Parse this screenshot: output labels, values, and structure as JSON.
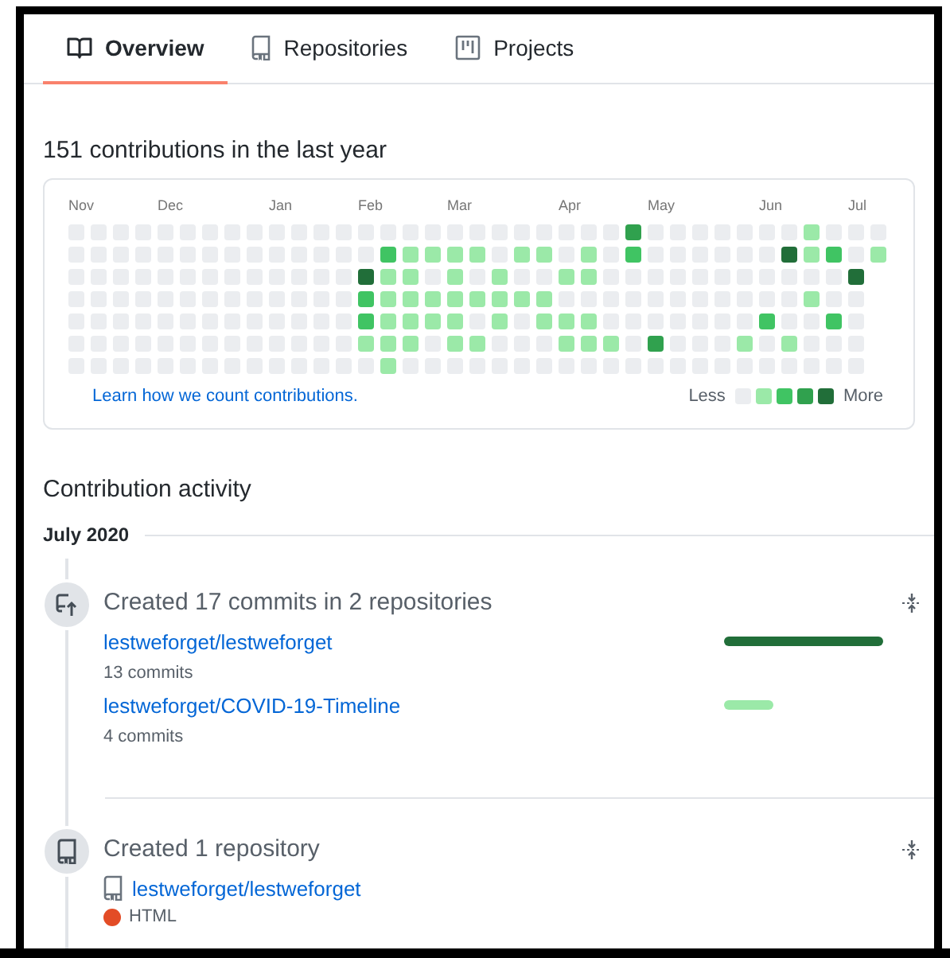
{
  "tabs": [
    {
      "label": "Overview",
      "selected": true
    },
    {
      "label": "Repositories",
      "selected": false
    },
    {
      "label": "Projects",
      "selected": false
    }
  ],
  "contributions": {
    "heading": "151 contributions in the last year",
    "months": [
      "Nov",
      "Dec",
      "Jan",
      "Feb",
      "Mar",
      "Apr",
      "May",
      "Jun",
      "Jul"
    ],
    "rows": [
      [
        {
          "color": "#ebedf0"
        },
        {
          "color": "#ebedf0"
        },
        {
          "color": "#ebedf0"
        },
        {
          "color": "#ebedf0"
        },
        {
          "color": "#ebedf0"
        },
        {
          "color": "#ebedf0"
        },
        {
          "color": "#ebedf0"
        },
        {
          "color": "#ebedf0"
        },
        {
          "color": "#ebedf0"
        },
        {
          "color": "#ebedf0"
        },
        {
          "color": "#ebedf0"
        },
        {
          "color": "#ebedf0"
        },
        {
          "color": "#ebedf0"
        },
        {
          "color": "#ebedf0"
        },
        {
          "color": "#ebedf0"
        },
        {
          "color": "#ebedf0"
        },
        {
          "color": "#ebedf0"
        },
        {
          "color": "#ebedf0"
        },
        {
          "color": "#ebedf0"
        },
        {
          "color": "#ebedf0"
        },
        {
          "color": "#ebedf0"
        },
        {
          "color": "#ebedf0"
        },
        {
          "color": "#ebedf0"
        },
        {
          "color": "#ebedf0"
        },
        {
          "color": "#ebedf0"
        },
        {
          "color": "#30a14e"
        },
        {
          "color": "#ebedf0"
        },
        {
          "color": "#ebedf0"
        },
        {
          "color": "#ebedf0"
        },
        {
          "color": "#ebedf0"
        },
        {
          "color": "#ebedf0"
        },
        {
          "color": "#ebedf0"
        },
        {
          "color": "#ebedf0"
        },
        {
          "color": "#9be9a8"
        },
        {
          "color": "#ebedf0"
        },
        {
          "color": "#ebedf0"
        },
        {
          "color": "#ebedf0"
        }
      ],
      [
        {
          "color": "#ebedf0"
        },
        {
          "color": "#ebedf0"
        },
        {
          "color": "#ebedf0"
        },
        {
          "color": "#ebedf0"
        },
        {
          "color": "#ebedf0"
        },
        {
          "color": "#ebedf0"
        },
        {
          "color": "#ebedf0"
        },
        {
          "color": "#ebedf0"
        },
        {
          "color": "#ebedf0"
        },
        {
          "color": "#ebedf0"
        },
        {
          "color": "#ebedf0"
        },
        {
          "color": "#ebedf0"
        },
        {
          "color": "#ebedf0"
        },
        {
          "color": "#ebedf0"
        },
        {
          "color": "#40c463"
        },
        {
          "color": "#9be9a8"
        },
        {
          "color": "#9be9a8"
        },
        {
          "color": "#9be9a8"
        },
        {
          "color": "#9be9a8"
        },
        {
          "color": "#ebedf0"
        },
        {
          "color": "#9be9a8"
        },
        {
          "color": "#9be9a8"
        },
        {
          "color": "#ebedf0"
        },
        {
          "color": "#9be9a8"
        },
        {
          "color": "#ebedf0"
        },
        {
          "color": "#40c463"
        },
        {
          "color": "#ebedf0"
        },
        {
          "color": "#ebedf0"
        },
        {
          "color": "#ebedf0"
        },
        {
          "color": "#ebedf0"
        },
        {
          "color": "#ebedf0"
        },
        {
          "color": "#ebedf0"
        },
        {
          "color": "#216e39"
        },
        {
          "color": "#9be9a8"
        },
        {
          "color": "#40c463"
        },
        {
          "color": "#ebedf0"
        },
        {
          "color": "#9be9a8"
        }
      ],
      [
        {
          "color": "#ebedf0"
        },
        {
          "color": "#ebedf0"
        },
        {
          "color": "#ebedf0"
        },
        {
          "color": "#ebedf0"
        },
        {
          "color": "#ebedf0"
        },
        {
          "color": "#ebedf0"
        },
        {
          "color": "#ebedf0"
        },
        {
          "color": "#ebedf0"
        },
        {
          "color": "#ebedf0"
        },
        {
          "color": "#ebedf0"
        },
        {
          "color": "#ebedf0"
        },
        {
          "color": "#ebedf0"
        },
        {
          "color": "#ebedf0"
        },
        {
          "color": "#216e39"
        },
        {
          "color": "#9be9a8"
        },
        {
          "color": "#9be9a8"
        },
        {
          "color": "#ebedf0"
        },
        {
          "color": "#9be9a8"
        },
        {
          "color": "#ebedf0"
        },
        {
          "color": "#9be9a8"
        },
        {
          "color": "#ebedf0"
        },
        {
          "color": "#ebedf0"
        },
        {
          "color": "#9be9a8"
        },
        {
          "color": "#9be9a8"
        },
        {
          "color": "#ebedf0"
        },
        {
          "color": "#ebedf0"
        },
        {
          "color": "#ebedf0"
        },
        {
          "color": "#ebedf0"
        },
        {
          "color": "#ebedf0"
        },
        {
          "color": "#ebedf0"
        },
        {
          "color": "#ebedf0"
        },
        {
          "color": "#ebedf0"
        },
        {
          "color": "#ebedf0"
        },
        {
          "color": "#ebedf0"
        },
        {
          "color": "#ebedf0"
        },
        {
          "color": "#216e39"
        }
      ],
      [
        {
          "color": "#ebedf0"
        },
        {
          "color": "#ebedf0"
        },
        {
          "color": "#ebedf0"
        },
        {
          "color": "#ebedf0"
        },
        {
          "color": "#ebedf0"
        },
        {
          "color": "#ebedf0"
        },
        {
          "color": "#ebedf0"
        },
        {
          "color": "#ebedf0"
        },
        {
          "color": "#ebedf0"
        },
        {
          "color": "#ebedf0"
        },
        {
          "color": "#ebedf0"
        },
        {
          "color": "#ebedf0"
        },
        {
          "color": "#ebedf0"
        },
        {
          "color": "#40c463"
        },
        {
          "color": "#9be9a8"
        },
        {
          "color": "#9be9a8"
        },
        {
          "color": "#9be9a8"
        },
        {
          "color": "#9be9a8"
        },
        {
          "color": "#9be9a8"
        },
        {
          "color": "#9be9a8"
        },
        {
          "color": "#9be9a8"
        },
        {
          "color": "#9be9a8"
        },
        {
          "color": "#ebedf0"
        },
        {
          "color": "#ebedf0"
        },
        {
          "color": "#ebedf0"
        },
        {
          "color": "#ebedf0"
        },
        {
          "color": "#ebedf0"
        },
        {
          "color": "#ebedf0"
        },
        {
          "color": "#ebedf0"
        },
        {
          "color": "#ebedf0"
        },
        {
          "color": "#ebedf0"
        },
        {
          "color": "#ebedf0"
        },
        {
          "color": "#ebedf0"
        },
        {
          "color": "#9be9a8"
        },
        {
          "color": "#ebedf0"
        },
        {
          "color": "#ebedf0"
        }
      ],
      [
        {
          "color": "#ebedf0"
        },
        {
          "color": "#ebedf0"
        },
        {
          "color": "#ebedf0"
        },
        {
          "color": "#ebedf0"
        },
        {
          "color": "#ebedf0"
        },
        {
          "color": "#ebedf0"
        },
        {
          "color": "#ebedf0"
        },
        {
          "color": "#ebedf0"
        },
        {
          "color": "#ebedf0"
        },
        {
          "color": "#ebedf0"
        },
        {
          "color": "#ebedf0"
        },
        {
          "color": "#ebedf0"
        },
        {
          "color": "#ebedf0"
        },
        {
          "color": "#40c463"
        },
        {
          "color": "#9be9a8"
        },
        {
          "color": "#9be9a8"
        },
        {
          "color": "#9be9a8"
        },
        {
          "color": "#9be9a8"
        },
        {
          "color": "#ebedf0"
        },
        {
          "color": "#9be9a8"
        },
        {
          "color": "#ebedf0"
        },
        {
          "color": "#9be9a8"
        },
        {
          "color": "#9be9a8"
        },
        {
          "color": "#9be9a8"
        },
        {
          "color": "#ebedf0"
        },
        {
          "color": "#ebedf0"
        },
        {
          "color": "#ebedf0"
        },
        {
          "color": "#ebedf0"
        },
        {
          "color": "#ebedf0"
        },
        {
          "color": "#ebedf0"
        },
        {
          "color": "#ebedf0"
        },
        {
          "color": "#40c463"
        },
        {
          "color": "#ebedf0"
        },
        {
          "color": "#ebedf0"
        },
        {
          "color": "#40c463"
        },
        {
          "color": "#ebedf0"
        }
      ],
      [
        {
          "color": "#ebedf0"
        },
        {
          "color": "#ebedf0"
        },
        {
          "color": "#ebedf0"
        },
        {
          "color": "#ebedf0"
        },
        {
          "color": "#ebedf0"
        },
        {
          "color": "#ebedf0"
        },
        {
          "color": "#ebedf0"
        },
        {
          "color": "#ebedf0"
        },
        {
          "color": "#ebedf0"
        },
        {
          "color": "#ebedf0"
        },
        {
          "color": "#ebedf0"
        },
        {
          "color": "#ebedf0"
        },
        {
          "color": "#ebedf0"
        },
        {
          "color": "#9be9a8"
        },
        {
          "color": "#9be9a8"
        },
        {
          "color": "#9be9a8"
        },
        {
          "color": "#ebedf0"
        },
        {
          "color": "#9be9a8"
        },
        {
          "color": "#9be9a8"
        },
        {
          "color": "#ebedf0"
        },
        {
          "color": "#ebedf0"
        },
        {
          "color": "#ebedf0"
        },
        {
          "color": "#9be9a8"
        },
        {
          "color": "#9be9a8"
        },
        {
          "color": "#9be9a8"
        },
        {
          "color": "#ebedf0"
        },
        {
          "color": "#30a14e"
        },
        {
          "color": "#ebedf0"
        },
        {
          "color": "#ebedf0"
        },
        {
          "color": "#ebedf0"
        },
        {
          "color": "#9be9a8"
        },
        {
          "color": "#ebedf0"
        },
        {
          "color": "#9be9a8"
        },
        {
          "color": "#ebedf0"
        },
        {
          "color": "#ebedf0"
        },
        {
          "color": "#ebedf0"
        }
      ],
      [
        {
          "color": "#ebedf0"
        },
        {
          "color": "#ebedf0"
        },
        {
          "color": "#ebedf0"
        },
        {
          "color": "#ebedf0"
        },
        {
          "color": "#ebedf0"
        },
        {
          "color": "#ebedf0"
        },
        {
          "color": "#ebedf0"
        },
        {
          "color": "#ebedf0"
        },
        {
          "color": "#ebedf0"
        },
        {
          "color": "#ebedf0"
        },
        {
          "color": "#ebedf0"
        },
        {
          "color": "#ebedf0"
        },
        {
          "color": "#ebedf0"
        },
        {
          "color": "#ebedf0"
        },
        {
          "color": "#9be9a8"
        },
        {
          "color": "#ebedf0"
        },
        {
          "color": "#ebedf0"
        },
        {
          "color": "#ebedf0"
        },
        {
          "color": "#ebedf0"
        },
        {
          "color": "#ebedf0"
        },
        {
          "color": "#ebedf0"
        },
        {
          "color": "#ebedf0"
        },
        {
          "color": "#ebedf0"
        },
        {
          "color": "#ebedf0"
        },
        {
          "color": "#ebedf0"
        },
        {
          "color": "#ebedf0"
        },
        {
          "color": "#ebedf0"
        },
        {
          "color": "#ebedf0"
        },
        {
          "color": "#ebedf0"
        },
        {
          "color": "#ebedf0"
        },
        {
          "color": "#ebedf0"
        },
        {
          "color": "#ebedf0"
        },
        {
          "color": "#ebedf0"
        },
        {
          "color": "#ebedf0"
        },
        {
          "color": "#ebedf0"
        },
        {
          "color": "#ebedf0"
        }
      ]
    ],
    "link": "Learn how we count contributions.",
    "legend": {
      "less": "Less",
      "more": "More",
      "swatches": [
        {
          "color": "#ebedf0"
        },
        {
          "color": "#9be9a8"
        },
        {
          "color": "#40c463"
        },
        {
          "color": "#30a14e"
        },
        {
          "color": "#216e39"
        }
      ]
    }
  },
  "activity": {
    "heading": "Contribution activity",
    "month": "July 2020",
    "events": [
      {
        "kind": "commits",
        "title": "Created 17 commits in 2 repositories",
        "items": [
          {
            "repo": "lestweforget/lestweforget",
            "detail": "13 commits",
            "level": 1,
            "color": "#216e39"
          },
          {
            "repo": "lestweforget/COVID-19-Timeline",
            "detail": "4 commits",
            "level": 0.31,
            "color": "#9be9a8"
          }
        ]
      },
      {
        "kind": "repository",
        "title": "Created 1 repository",
        "items": [
          {
            "repo": "lestweforget/lestweforget",
            "language": "HTML",
            "color": "#e34c26"
          }
        ]
      }
    ]
  }
}
